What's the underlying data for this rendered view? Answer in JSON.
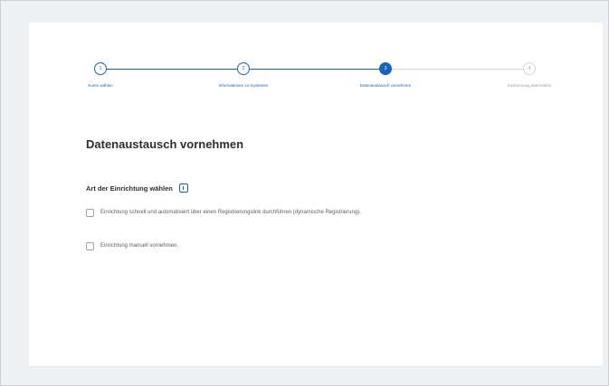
{
  "stepper": {
    "steps": [
      {
        "number": "1",
        "label": "Konto wählen",
        "state": "complete"
      },
      {
        "number": "2",
        "label": "Informationen zu Systemen",
        "state": "complete"
      },
      {
        "number": "3",
        "label": "Datenaustausch vornehmen",
        "state": "active"
      },
      {
        "number": "4",
        "label": "Zustimmung übermitteln",
        "state": "pending"
      }
    ],
    "colors": {
      "active": "#1565c0",
      "inactive": "#d3d7dc"
    }
  },
  "page": {
    "title": "Datenaustausch vornehmen",
    "section_label": "Art der Einrichtung wählen",
    "options": [
      {
        "label": "Einrichtung schnell und automatisiert über einen Registrierungslink durchführen (dynamische Registrierung)."
      },
      {
        "label": "Einrichtung manuell vornehmen."
      }
    ]
  },
  "icons": {
    "info": "info-icon"
  }
}
